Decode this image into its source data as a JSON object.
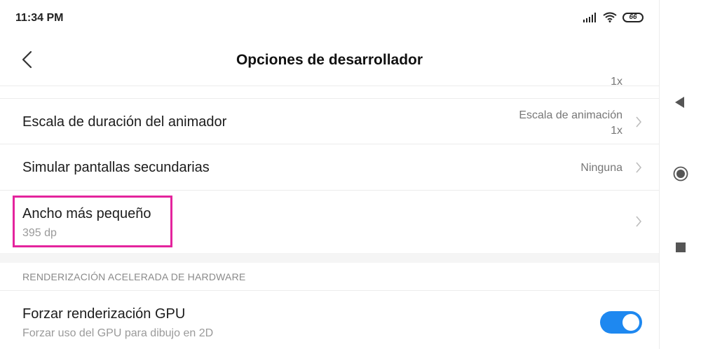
{
  "status_bar": {
    "time": "11:34 PM",
    "battery": "66"
  },
  "header": {
    "title": "Opciones de desarrollador"
  },
  "partial_row": {
    "value": "1x"
  },
  "rows": [
    {
      "label": "Escala de duración del animador",
      "value_line1": "Escala de animación",
      "value_line2": "1x"
    },
    {
      "label": "Simular pantallas secundarias",
      "value": "Ninguna"
    },
    {
      "label": "Ancho más pequeño",
      "subtitle": "395 dp"
    }
  ],
  "section": {
    "header": "RENDERIZACIÓN ACELERADA DE HARDWARE"
  },
  "gpu_row": {
    "label": "Forzar renderización GPU",
    "subtitle": "Forzar uso del GPU para dibujo en 2D",
    "enabled": true
  },
  "colors": {
    "accent_toggle": "#1e88f0",
    "highlight": "#e4249d"
  }
}
